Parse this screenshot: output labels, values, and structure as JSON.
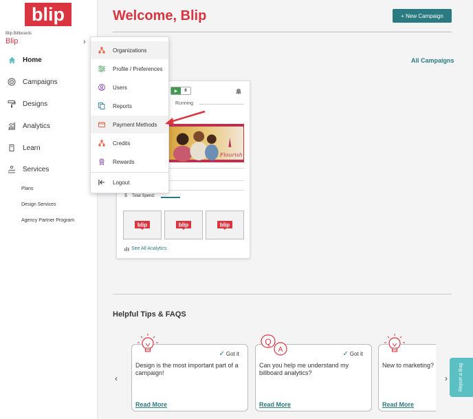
{
  "brand": {
    "logo_text": "blip",
    "accent_color": "#d9343f",
    "teal_color": "#2a7a82"
  },
  "account": {
    "label": "Blip Billboards",
    "name": "Blip"
  },
  "sidebar": {
    "items": [
      {
        "label": "Home",
        "icon": "home-icon",
        "active": true
      },
      {
        "label": "Campaigns",
        "icon": "target-icon"
      },
      {
        "label": "Designs",
        "icon": "paint-roller-icon"
      },
      {
        "label": "Analytics",
        "icon": "chart-icon"
      },
      {
        "label": "Learn",
        "icon": "book-icon"
      },
      {
        "label": "Services",
        "icon": "handshake-icon"
      }
    ],
    "sub_items": [
      "Plans",
      "Design Services",
      "Agency Partner Program"
    ]
  },
  "header": {
    "title": "Welcome, Blip",
    "new_campaign_label": "+ New Campaign"
  },
  "campaigns": {
    "all_link": "All Campaigns",
    "card": {
      "play_glyph": "▶",
      "pause_glyph": "II",
      "status": "Running",
      "creative_text": "Flourish",
      "spend_icon": "$",
      "spend_label": "Total Spend:",
      "spend_fraction": 0.45,
      "thumb_logo": "blip",
      "see_all": "See All Analytics"
    }
  },
  "dropdown": {
    "items": [
      {
        "label": "Organizations",
        "icon": "org-icon",
        "highlighted": true
      },
      {
        "label": "Profile / Preferences",
        "icon": "sliders-icon"
      },
      {
        "label": "Users",
        "icon": "user-circle-icon"
      },
      {
        "label": "Reports",
        "icon": "copy-icon"
      },
      {
        "label": "Payment Methods",
        "icon": "credit-card-icon",
        "highlighted": true
      },
      {
        "label": "Credits",
        "icon": "org-icon"
      },
      {
        "label": "Rewards",
        "icon": "award-icon"
      },
      {
        "label": "Logout",
        "icon": "logout-icon"
      }
    ]
  },
  "tips": {
    "title": "Helpful Tips & FAQS",
    "got_it": "Got it",
    "read_more": "Read More",
    "prev_glyph": "‹",
    "next_glyph": "›",
    "cards": [
      {
        "text": "Design is the most important part of a campaign!",
        "icon": "lightbulb-icon"
      },
      {
        "text": "Can you help me understand my billboard analytics?",
        "icon": "qa-icon",
        "qa_q": "Q",
        "qa_a": "A"
      },
      {
        "text": "New to marketing? I great place to start.",
        "icon": "lightbulb-icon"
      }
    ]
  },
  "report_bug": "Report a Bug"
}
